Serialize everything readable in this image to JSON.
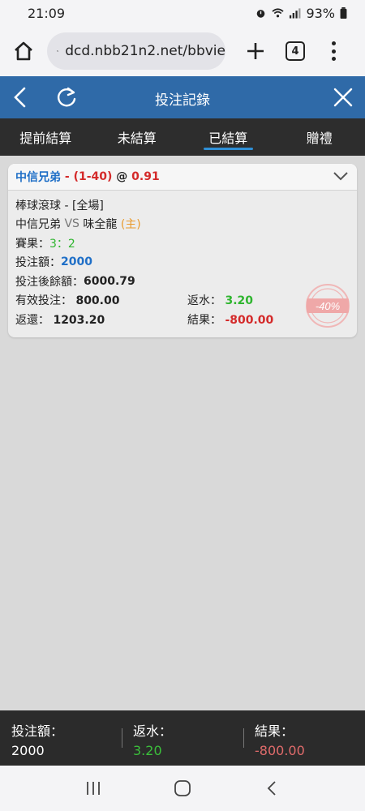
{
  "status_bar": {
    "time": "21:09",
    "battery": "93%"
  },
  "browser": {
    "url": "dcd.nbb21n2.net/bbvie",
    "tab_count": "4"
  },
  "header": {
    "title": "投注記錄"
  },
  "tabs": [
    {
      "label": "提前結算",
      "active": false
    },
    {
      "label": "未結算",
      "active": false
    },
    {
      "label": "已結算",
      "active": true
    },
    {
      "label": "贈禮",
      "active": false
    }
  ],
  "bet": {
    "team": "中信兄弟",
    "handicap_sep": " - ",
    "handicap": "(1-40)",
    "at": " @ ",
    "odds": "0.91",
    "market": "棒球滾球 - [全場]",
    "home_team": "中信兄弟",
    "vs": " VS ",
    "away_team": "味全龍",
    "home_tag": " (主)",
    "score_label": "賽果：",
    "score": "3：2",
    "stake_label": "投注額：",
    "stake": "2000",
    "balance_label": "投注後餘額：",
    "balance": "6000.79",
    "valid_label": "有效投注：",
    "valid": "800.00",
    "rebate_label": "返水：",
    "rebate": "3.20",
    "return_label": "返還：",
    "return": "1203.20",
    "result_label": "結果：",
    "result": "-800.00",
    "stamp": "-40%"
  },
  "summary": {
    "stake_label": "投注額：",
    "stake": "2000",
    "rebate_label": "返水：",
    "rebate": "3.20",
    "result_label": "結果：",
    "result": "-800.00"
  },
  "colors": {
    "header": "#2f6aa8",
    "tabs_bg": "#2d2d2d",
    "accent": "#2f8fd6",
    "loss": "#d42a2a",
    "win": "#2fb52f"
  }
}
